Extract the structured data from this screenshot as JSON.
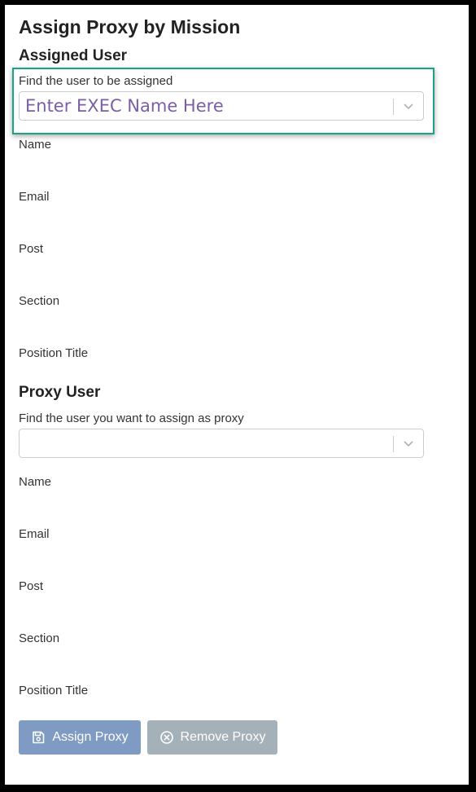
{
  "page": {
    "title": "Assign Proxy by Mission"
  },
  "assigned_user": {
    "heading": "Assigned User",
    "find_label": "Find the user to be assigned",
    "select_placeholder": "Enter EXEC Name Here",
    "fields": [
      "Name",
      "Email",
      "Post",
      "Section",
      "Position Title"
    ]
  },
  "proxy_user": {
    "heading": "Proxy User",
    "find_label": "Find the user you want to assign as proxy",
    "select_placeholder": "",
    "fields": [
      "Name",
      "Email",
      "Post",
      "Section",
      "Position Title"
    ]
  },
  "actions": {
    "assign_label": "Assign Proxy",
    "assign_icon": "save-icon",
    "remove_label": "Remove Proxy",
    "remove_icon": "circle-x-icon"
  },
  "colors": {
    "highlight": "#1aa386",
    "placeholder": "#7b5ea7",
    "assign_button": "#7f9bc3",
    "remove_button": "#a5b1b8"
  }
}
